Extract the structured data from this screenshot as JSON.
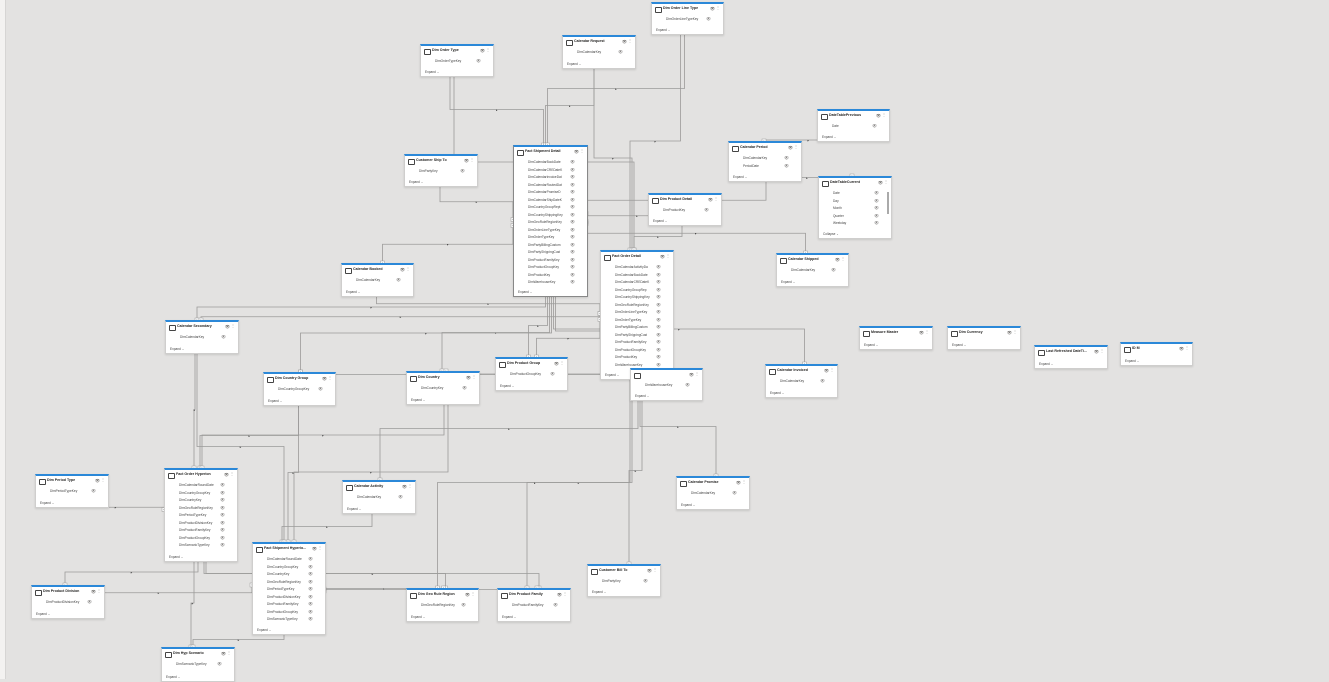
{
  "tables": [
    {
      "id": "dim-order-line-type",
      "title": "Dim Order Line Type",
      "fields": [
        "DimOrderLineTypeKey"
      ],
      "footer": "Expand"
    },
    {
      "id": "dim-order-type",
      "title": "Dim Order Type",
      "fields": [
        "DimOrderTypeKey"
      ],
      "footer": "Expand"
    },
    {
      "id": "calendar-request",
      "title": "Calendar Request",
      "fields": [
        "DimCalendarKey"
      ],
      "footer": "Expand"
    },
    {
      "id": "date-table-previous",
      "title": "DateTablePrevious",
      "fields": [
        "Date"
      ],
      "footer": "Expand"
    },
    {
      "id": "calendar-period",
      "title": "Calendar Period",
      "fields": [
        "DimCalendarKey",
        "PeriodDate"
      ],
      "footer": "Expand"
    },
    {
      "id": "date-table-current",
      "title": "DateTableCurrent",
      "fields": [
        "Date",
        "Day",
        "Month",
        "Quarter",
        "Weekday"
      ],
      "footer": "Collapse"
    },
    {
      "id": "customer-ship-to",
      "title": "Customer Ship To",
      "fields": [
        "DimPartyKey"
      ],
      "footer": "Expand"
    },
    {
      "id": "fact-shipment-detail",
      "title": "Fact Shipment Detail",
      "fields": [
        "DimCalendarBookDate",
        "DimCalendarCREDateK",
        "DimCalendarInvoiceDat",
        "DimCalendarRoutedDat",
        "DimCalendarPromiseD",
        "DimCalendarShipDateK",
        "DimCountryGroupRept",
        "DimCountryShippingKey",
        "DimGeoRuleRegionKey",
        "DimOrderLineTypeKey",
        "DimOrderTypeKey",
        "DimPartyBillingCustom",
        "DimPartyShippingCust",
        "DimProductFamilyKey",
        "DimProductGroupKey",
        "DimProductKey",
        "DimWarehouseKey"
      ],
      "footer": "Expand"
    },
    {
      "id": "dim-product-detail",
      "title": "Dim Product Detail",
      "fields": [
        "DimProductKey"
      ],
      "footer": "Expand"
    },
    {
      "id": "fact-order-detail",
      "title": "Fact Order Detail",
      "fields": [
        "DimCalendarActivityDa",
        "DimCalendarBookDate",
        "DimCalendarCREDateK",
        "DimCountryGroupRep",
        "DimCountryShippingKey",
        "DimGeoRuleRegionKey",
        "DimOrderLineTypeKey",
        "DimOrderTypeKey",
        "DimPartyBillingCustom",
        "DimPartyShippingCust",
        "DimProductFamilyKey",
        "DimProductGroupKey",
        "DimProductKey",
        "DimWarehouseKey"
      ],
      "footer": "Expand"
    },
    {
      "id": "calendar-booked",
      "title": "Calendar Booked",
      "fields": [
        "DimCalendarKey"
      ],
      "footer": "Expand"
    },
    {
      "id": "calendar-shipped",
      "title": "Calendar Shipped",
      "fields": [
        "DimCalendarKey"
      ],
      "footer": "Expand"
    },
    {
      "id": "calendar-secondary",
      "title": "Calendar Secondary",
      "fields": [
        "DimCalendarKey"
      ],
      "footer": "Expand"
    },
    {
      "id": "measure-master",
      "title": "Measure Master",
      "fields": [],
      "footer": "Expand"
    },
    {
      "id": "dim-currency",
      "title": "Dim Currency",
      "fields": [],
      "footer": "Expand"
    },
    {
      "id": "last-refreshed",
      "title": "Last Refreshed DateTi...",
      "fields": [],
      "footer": "Expand"
    },
    {
      "id": "id-m",
      "title": "ID M",
      "fields": [],
      "footer": "Expand"
    },
    {
      "id": "dim-product-group",
      "title": "Dim Product Group",
      "fields": [
        "DimProductGroupKey"
      ],
      "footer": "Expand"
    },
    {
      "id": "dim-warehouse",
      "title": "",
      "fields": [
        "DimWarehouseKey"
      ],
      "footer": "Expand"
    },
    {
      "id": "calendar-invoiced",
      "title": "Calendar Invoiced",
      "fields": [
        "DimCalendarKey"
      ],
      "footer": "Expand"
    },
    {
      "id": "dim-country-group",
      "title": "Dim Country Group",
      "fields": [
        "DimCountryGroupKey"
      ],
      "footer": "Expand"
    },
    {
      "id": "dim-country",
      "title": "Dim Country",
      "fields": [
        "DimCountryKey"
      ],
      "footer": "Expand"
    },
    {
      "id": "dim-period-type",
      "title": "Dim Period Type",
      "fields": [
        "DimPeriodTypeKey"
      ],
      "footer": "Expand"
    },
    {
      "id": "fact-order-hyperion",
      "title": "Fact Order Hyperion",
      "fields": [
        "DimCalendarRoundDate",
        "DimCountryGroupKey",
        "DimCountryKey",
        "DimGeoRuleRegionKey",
        "DimPeriodTypeKey",
        "DimProductDivisionKey",
        "DimProductFamilyKey",
        "DimProductGroupKey",
        "DimScenarioTypeKey"
      ],
      "footer": "Expand"
    },
    {
      "id": "calendar-activity",
      "title": "Calendar Activity",
      "fields": [
        "DimCalendarKey"
      ],
      "footer": "Expand"
    },
    {
      "id": "calendar-promise",
      "title": "Calendar Promise",
      "fields": [
        "DimCalendarKey"
      ],
      "footer": "Expand"
    },
    {
      "id": "fact-shipment-hyperion",
      "title": "Fact Shipment Hyperio...",
      "fields": [
        "DimCalendarRoundDate",
        "DimCountryGroupKey",
        "DimCountryKey",
        "DimGeoRuleRegionKey",
        "DimPeriodTypeKey",
        "DimProductDivisionKey",
        "DimProductFamilyKey",
        "DimProductGroupKey",
        "DimScenarioTypeKey"
      ],
      "footer": "Expand"
    },
    {
      "id": "customer-bill-to",
      "title": "Customer Bill To",
      "fields": [
        "DimPartyKey"
      ],
      "footer": "Expand"
    },
    {
      "id": "dim-product-division",
      "title": "Dim Product Division",
      "fields": [
        "DimProductDivisionKey"
      ],
      "footer": "Expand"
    },
    {
      "id": "dim-geo-rule-region",
      "title": "Dim Geo Rule Region",
      "fields": [
        "DimGeoRuleRegionKey"
      ],
      "footer": "Expand"
    },
    {
      "id": "dim-product-family",
      "title": "Dim Product Family",
      "fields": [
        "DimProductFamilyKey"
      ],
      "footer": "Expand"
    },
    {
      "id": "dim-hyp-scenario",
      "title": "Dim Hyp Scenario",
      "fields": [
        "DimScenarioTypeKey"
      ],
      "footer": "Expand"
    }
  ],
  "cardinality": {
    "one": "1",
    "many": "*"
  }
}
